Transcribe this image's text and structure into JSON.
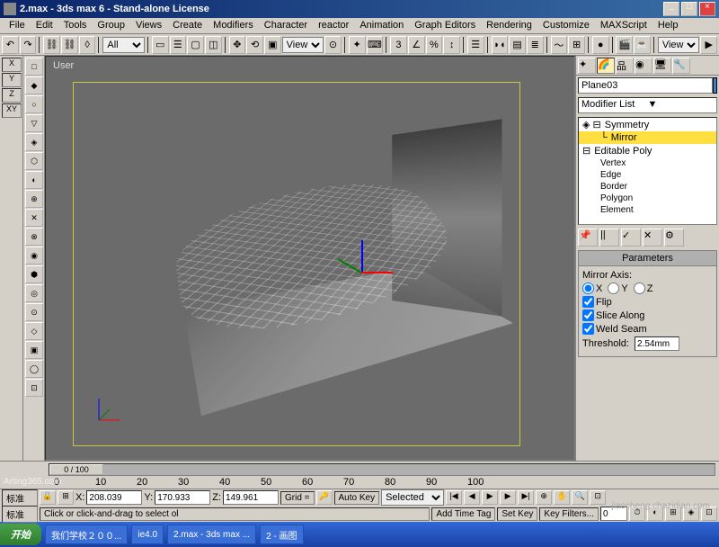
{
  "window": {
    "title": "2.max - 3ds max 6 - Stand-alone License"
  },
  "menu": [
    "File",
    "Edit",
    "Tools",
    "Group",
    "Views",
    "Create",
    "Modifiers",
    "Character",
    "reactor",
    "Animation",
    "Graph Editors",
    "Rendering",
    "Customize",
    "MAXScript",
    "Help"
  ],
  "toolbar": {
    "selection_filter": "All",
    "ref_coord": "View"
  },
  "snap": [
    "X",
    "Y",
    "Z",
    "XY"
  ],
  "viewport": {
    "label": "User"
  },
  "command_panel": {
    "object_name": "Plane03",
    "modifier_list_label": "Modifier List",
    "stack": {
      "symmetry": "Symmetry",
      "mirror": "Mirror",
      "editable_poly": "Editable Poly",
      "subs": [
        "Vertex",
        "Edge",
        "Border",
        "Polygon",
        "Element"
      ]
    },
    "parameters": {
      "title": "Parameters",
      "axis_label": "Mirror Axis:",
      "axis_x": "X",
      "axis_y": "Y",
      "axis_z": "Z",
      "flip": "Flip",
      "slice": "Slice Along",
      "weld": "Weld Seam",
      "threshold_label": "Threshold:",
      "threshold": "2.54mm"
    }
  },
  "timeline": {
    "current": "0 / 100",
    "ticks": [
      "0",
      "10",
      "20",
      "30",
      "40",
      "50",
      "60",
      "70",
      "80",
      "90",
      "100"
    ]
  },
  "status": {
    "coord_x_label": "X:",
    "coord_x": "208.039",
    "coord_y_label": "Y:",
    "coord_y": "170.933",
    "coord_z_label": "Z:",
    "coord_z": "149.961",
    "grid": "Grid =",
    "autokey": "Auto Key",
    "setkey": "Set Key",
    "selected": "Selected",
    "keyfilters": "Key Filters...",
    "prompt": "Click or click-and-drag to select ol",
    "addtag": "Add Time Tag",
    "label1": "标准",
    "label2": "标准"
  },
  "taskbar": {
    "start": "开始",
    "items": [
      "我们学校２００...",
      "ie4.0",
      "2.max - 3ds max ...",
      "2 - 画图"
    ]
  },
  "watermarks": {
    "w1": "Arting365.com",
    "w2": "jiaocheng.chazidian.com"
  }
}
